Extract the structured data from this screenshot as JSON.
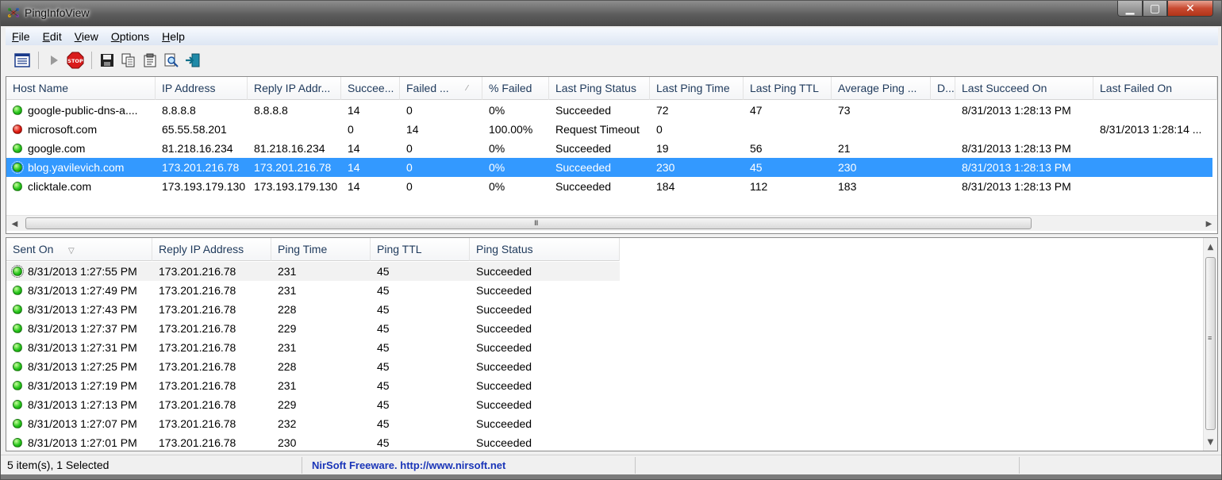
{
  "window": {
    "title": "PingInfoView",
    "controls": {
      "minimize": "▁",
      "maximize": "▢",
      "close": "✕"
    }
  },
  "menu": [
    "File",
    "Edit",
    "View",
    "Options",
    "Help"
  ],
  "toolbar": {
    "buttons": [
      "options-icon",
      "play-icon",
      "stop-icon",
      "save-icon",
      "copy-icon",
      "properties-icon",
      "find-icon",
      "exit-icon"
    ],
    "stop_label": "STOP"
  },
  "hosts": {
    "columns": [
      "Host Name",
      "IP Address",
      "Reply IP Addr...",
      "Succee...",
      "Failed ...",
      "% Failed",
      "Last Ping Status",
      "Last Ping Time",
      "Last Ping TTL",
      "Average Ping ...",
      "D...",
      "Last Succeed On",
      "Last Failed On"
    ],
    "rows": [
      {
        "status": "ok",
        "cells": [
          "google-public-dns-a....",
          "8.8.8.8",
          "8.8.8.8",
          "14",
          "0",
          "0%",
          "Succeeded",
          "72",
          "47",
          "73",
          "",
          "8/31/2013 1:28:13 PM",
          ""
        ]
      },
      {
        "status": "fail",
        "cells": [
          "microsoft.com",
          "65.55.58.201",
          "",
          "0",
          "14",
          "100.00%",
          "Request Timeout",
          "0",
          "",
          "",
          "",
          "",
          "8/31/2013 1:28:14 ..."
        ]
      },
      {
        "status": "ok",
        "cells": [
          "google.com",
          "81.218.16.234",
          "81.218.16.234",
          "14",
          "0",
          "0%",
          "Succeeded",
          "19",
          "56",
          "21",
          "",
          "8/31/2013 1:28:13 PM",
          ""
        ]
      },
      {
        "status": "ok",
        "selected": true,
        "cells": [
          "blog.yavilevich.com",
          "173.201.216.78",
          "173.201.216.78",
          "14",
          "0",
          "0%",
          "Succeeded",
          "230",
          "45",
          "230",
          "",
          "8/31/2013 1:28:13 PM",
          ""
        ]
      },
      {
        "status": "ok",
        "cells": [
          "clicktale.com",
          "173.193.179.130",
          "173.193.179.130",
          "14",
          "0",
          "0%",
          "Succeeded",
          "184",
          "112",
          "183",
          "",
          "8/31/2013 1:28:13 PM",
          ""
        ]
      }
    ],
    "scroll_grip": "III"
  },
  "history": {
    "columns": [
      "Sent On",
      "Reply IP Address",
      "Ping Time",
      "Ping TTL",
      "Ping Status"
    ],
    "rows": [
      {
        "cells": [
          "8/31/2013 1:27:55 PM",
          "173.201.216.78",
          "231",
          "45",
          "Succeeded"
        ]
      },
      {
        "cells": [
          "8/31/2013 1:27:49 PM",
          "173.201.216.78",
          "231",
          "45",
          "Succeeded"
        ]
      },
      {
        "cells": [
          "8/31/2013 1:27:43 PM",
          "173.201.216.78",
          "228",
          "45",
          "Succeeded"
        ]
      },
      {
        "cells": [
          "8/31/2013 1:27:37 PM",
          "173.201.216.78",
          "229",
          "45",
          "Succeeded"
        ]
      },
      {
        "cells": [
          "8/31/2013 1:27:31 PM",
          "173.201.216.78",
          "231",
          "45",
          "Succeeded"
        ]
      },
      {
        "cells": [
          "8/31/2013 1:27:25 PM",
          "173.201.216.78",
          "228",
          "45",
          "Succeeded"
        ]
      },
      {
        "cells": [
          "8/31/2013 1:27:19 PM",
          "173.201.216.78",
          "231",
          "45",
          "Succeeded"
        ]
      },
      {
        "cells": [
          "8/31/2013 1:27:13 PM",
          "173.201.216.78",
          "229",
          "45",
          "Succeeded"
        ]
      },
      {
        "cells": [
          "8/31/2013 1:27:07 PM",
          "173.201.216.78",
          "232",
          "45",
          "Succeeded"
        ]
      },
      {
        "cells": [
          "8/31/2013 1:27:01 PM",
          "173.201.216.78",
          "230",
          "45",
          "Succeeded"
        ]
      }
    ],
    "scroll_grip": "≡"
  },
  "status": {
    "items": "5 item(s), 1 Selected",
    "credits": "NirSoft Freeware.  http://www.nirsoft.net"
  },
  "colors": {
    "selection": "#3399ff",
    "ok": "#25c41a",
    "fail": "#e0190e",
    "credits": "#1a35b8"
  }
}
